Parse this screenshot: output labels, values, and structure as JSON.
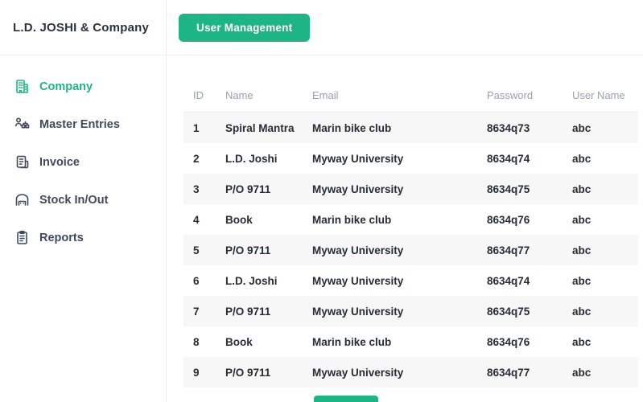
{
  "colors": {
    "accent_green": "#1eb585",
    "sidebar_text": "#3f4a5a",
    "table_header_text": "#9aa1a9",
    "table_body_text": "#262d36",
    "row_stripe": "#f7f7f8"
  },
  "sidebar": {
    "company_name": "L.D. JOSHI & Company",
    "items": [
      {
        "label": "Company",
        "icon": "building-icon",
        "active": true
      },
      {
        "label": "Master Entries",
        "icon": "org-chart-icon",
        "active": false
      },
      {
        "label": "Invoice",
        "icon": "invoice-icon",
        "active": false
      },
      {
        "label": "Stock In/Out",
        "icon": "warehouse-icon",
        "active": false
      },
      {
        "label": "Reports",
        "icon": "clipboard-icon",
        "active": false
      }
    ]
  },
  "header": {
    "user_management_button": "User Management"
  },
  "table": {
    "columns": [
      "ID",
      "Name",
      "Email",
      "Password",
      "User Name"
    ],
    "rows": [
      [
        "1",
        "Spiral Mantra",
        "Marin bike club",
        "8634q73",
        "abc"
      ],
      [
        "2",
        "L.D. Joshi",
        "Myway University",
        "8634q74",
        "abc"
      ],
      [
        "3",
        "P/O 9711",
        "Myway University",
        "8634q75",
        "abc"
      ],
      [
        "4",
        "Book",
        "Marin bike club",
        "8634q76",
        "abc"
      ],
      [
        "5",
        "P/O 9711",
        "Myway University",
        "8634q77",
        "abc"
      ],
      [
        "6",
        "L.D. Joshi",
        "Myway University",
        "8634q74",
        "abc"
      ],
      [
        "7",
        "P/O 9711",
        "Myway University",
        "8634q75",
        "abc"
      ],
      [
        "8",
        "Book",
        "Marin bike club",
        "8634q76",
        "abc"
      ],
      [
        "9",
        "P/O 9711",
        "Myway University",
        "8634q77",
        "abc"
      ]
    ]
  }
}
